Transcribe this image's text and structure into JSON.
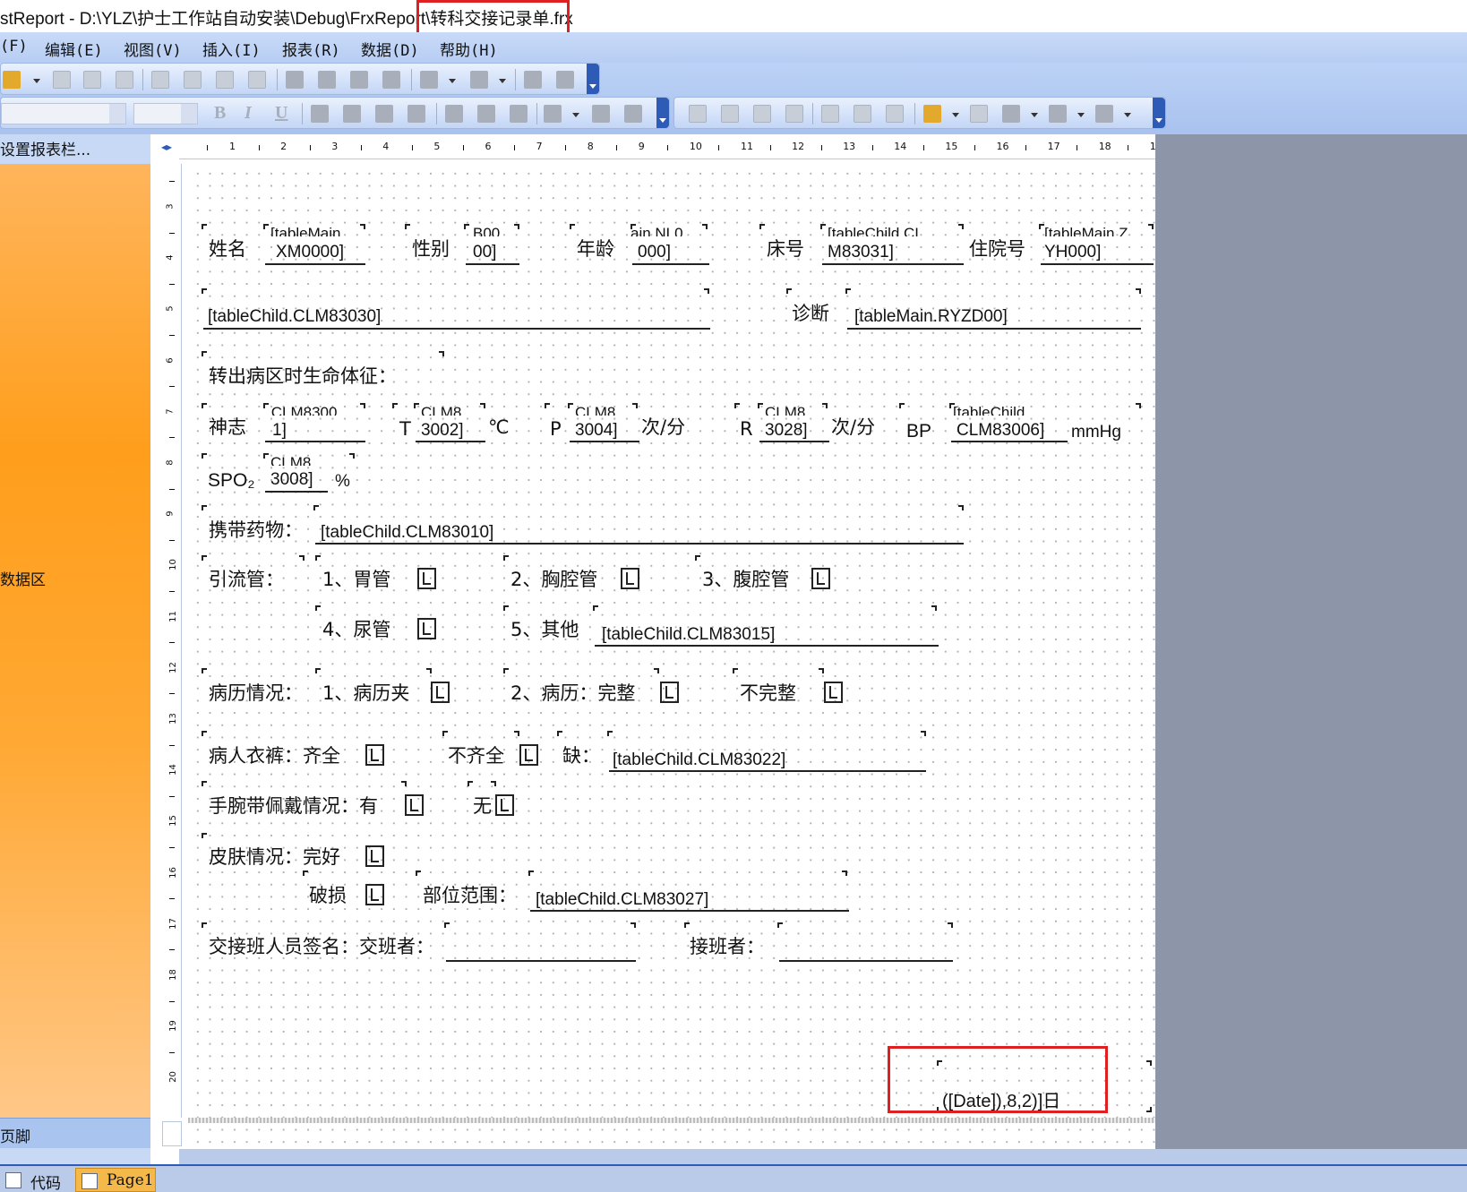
{
  "window": {
    "title_prefix": "stReport - D:\\YLZ\\护士工作站自动安装\\Debug\\FrxReport\\",
    "title_file": "转科交接记录单.frx"
  },
  "menu": [
    "(F)",
    "编辑(E)",
    "视图(V)",
    "插入(I)",
    "报表(R)",
    "数据(D)",
    "帮助(H)"
  ],
  "toolbar_format": {
    "bold": "B",
    "italic": "I",
    "underline": "U"
  },
  "bands": {
    "header": "设置报表栏...",
    "data": "数据区",
    "footer": "页脚"
  },
  "ruler": {
    "horizontal": [
      "1",
      "2",
      "3",
      "4",
      "5",
      "6",
      "7",
      "8",
      "9",
      "10",
      "11",
      "12",
      "13",
      "14",
      "15",
      "16",
      "17",
      "18",
      "19"
    ],
    "vertical": [
      "3",
      "4",
      "5",
      "6",
      "7",
      "8",
      "9",
      "10",
      "11",
      "12",
      "13",
      "14",
      "15",
      "16",
      "17",
      "18",
      "19",
      "20"
    ]
  },
  "report": {
    "row1": {
      "name_label": "姓名",
      "name_top": "[tableMain",
      "name_value": "XM0000]",
      "sex_label": "性别",
      "sex_top": "B00",
      "sex_value": "00]",
      "age_label": "年龄",
      "age_top": "ain.NL0",
      "age_value": "000]",
      "bed_label": "床号",
      "bed_top": "[tableChild.CL",
      "bed_value": "M83031]",
      "zyh_label": "住院号",
      "zyh_top": "[tableMain.Z",
      "zyh_value": "YH000]"
    },
    "row2": {
      "dept_field": "[tableChild.CLM83030]",
      "diag_label": "诊断",
      "diag_field": "[tableMain.RYZD00]"
    },
    "vitals_title": "转出病区时生命体征：",
    "vitals": {
      "consc_label": "神志",
      "consc_top": ".CLM8300",
      "consc_value": "1]",
      "t_label": "T",
      "t_top": "CLM8",
      "t_value": "3002]",
      "t_unit": "℃",
      "p_label": "P",
      "p_top": "CLM8",
      "p_value": "3004]",
      "p_unit": "次/分",
      "r_label": "R",
      "r_top": "CLM8",
      "r_value": "3028]",
      "r_unit": "次/分",
      "bp_label": "BP",
      "bp_top": "[tableChild.",
      "bp_value": "CLM83006]",
      "bp_unit": "mmHg",
      "spo2_label": "SPO₂",
      "spo2_top": "CLM8",
      "spo2_value": "3008]",
      "spo2_unit": "%"
    },
    "drugs": {
      "label": "携带药物：",
      "field": "[tableChild.CLM83010]"
    },
    "drain": {
      "label": "引流管：",
      "opt1": "1、胃管",
      "opt2": "2、胸腔管",
      "opt3": "3、腹腔管",
      "opt4": "4、尿管",
      "opt5": "5、其他",
      "other_field": "[tableChild.CLM83015]"
    },
    "record": {
      "label": "病历情况：",
      "opt1": "1、病历夹",
      "opt2": "2、病历：完整",
      "opt3": "不完整"
    },
    "clothes": {
      "label": "病人衣裤：齐全",
      "opt2": "不齐全",
      "lack": "缺：",
      "field": "[tableChild.CLM83022]"
    },
    "wristband": {
      "label": "手腕带佩戴情况：有",
      "opt2": "无"
    },
    "skin": {
      "label": "皮肤情况：完好",
      "opt2": "破损",
      "range_label": "部位范围：",
      "range_field": "[tableChild.CLM83027]"
    },
    "sign": {
      "label": "交接班人员签名：交班者：",
      "receiver": "接班者："
    },
    "date_field": "([Date]),8,2)]日"
  },
  "tabs": {
    "code": "代码",
    "page1": "Page1"
  }
}
